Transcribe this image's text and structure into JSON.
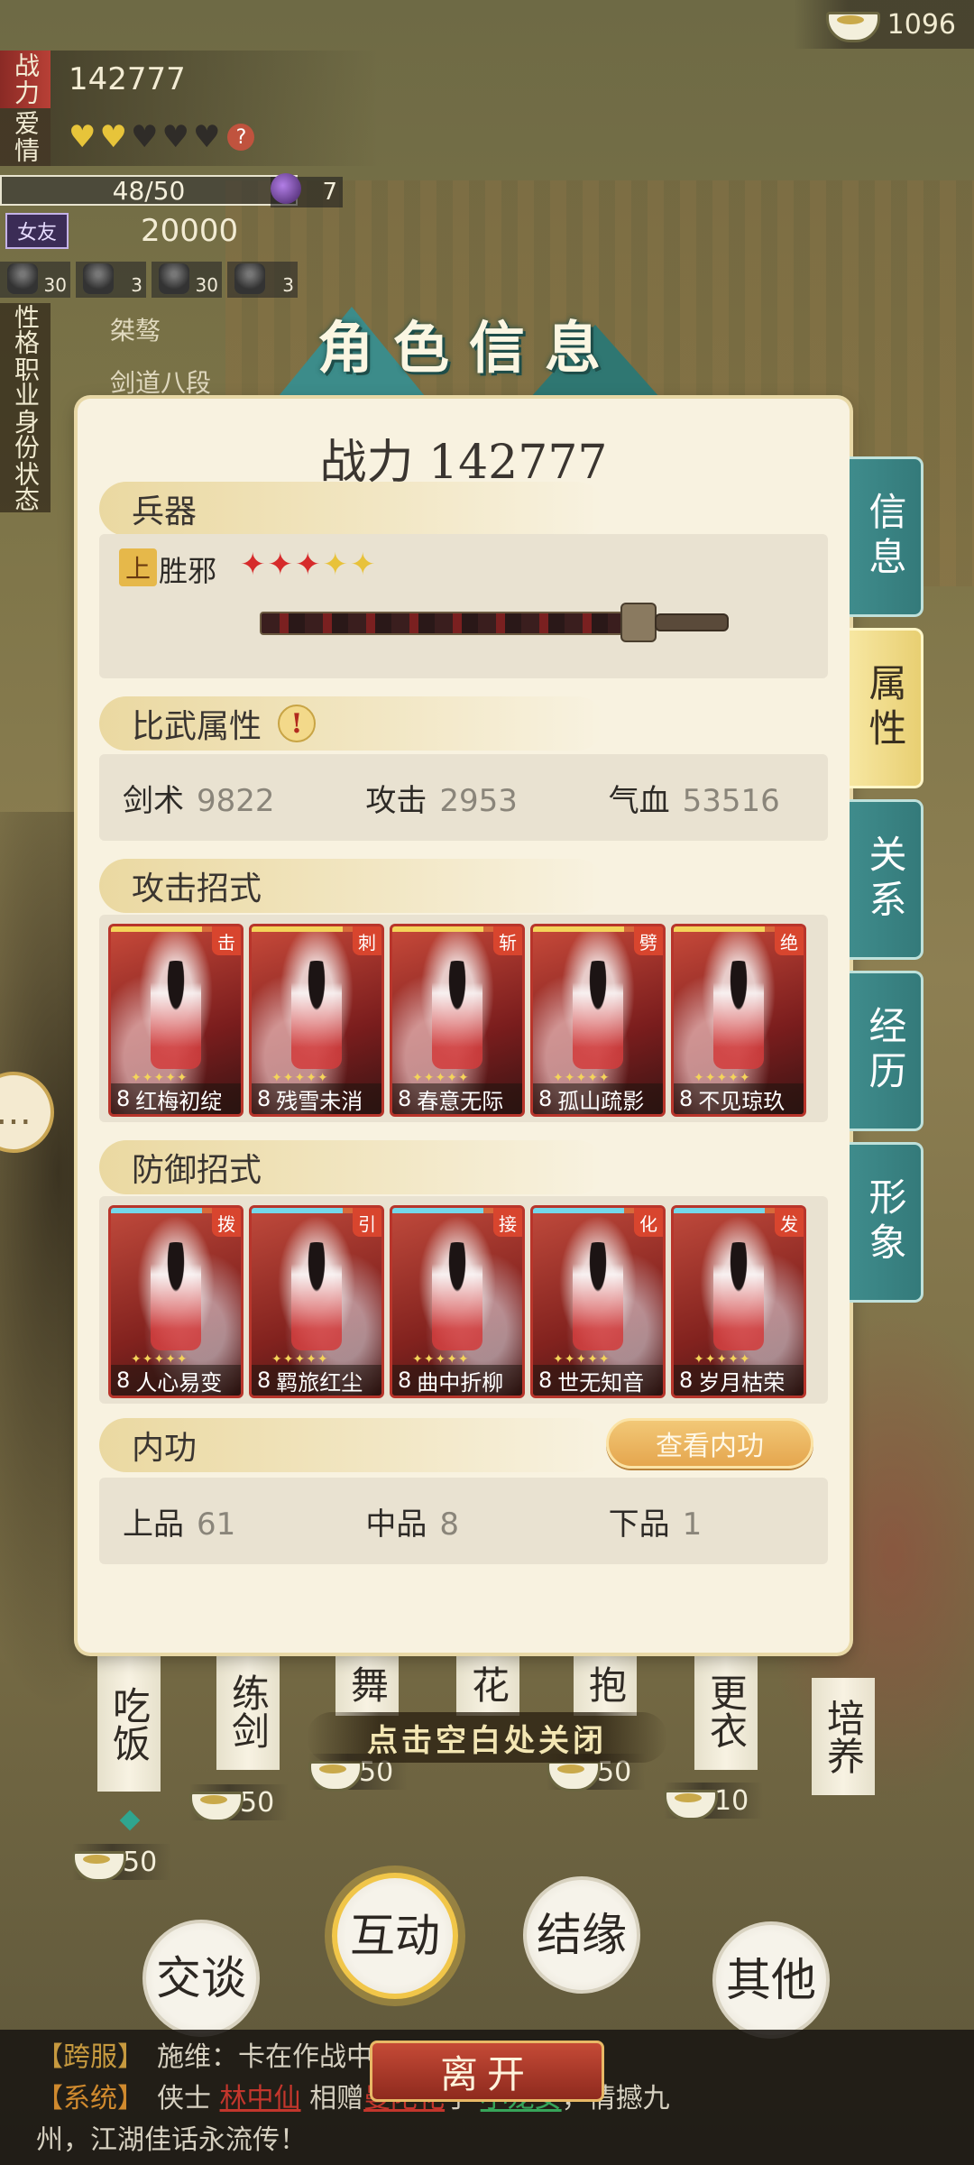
{
  "currency": {
    "icon": "rice-bowl-icon",
    "value": "1096"
  },
  "stats": {
    "power_label": "战力",
    "power_value": "142777",
    "love_label": "爱情",
    "hearts": {
      "filled": 2,
      "total": 5
    },
    "affection": "48/50",
    "gem_count": "7",
    "friend_badge": "女友",
    "friend_value": "20000",
    "gear": [
      "30",
      "3",
      "30",
      "3"
    ],
    "attributes": [
      {
        "label": "性格",
        "value": "桀骜"
      },
      {
        "label": "职业",
        "value": "剑道八段"
      },
      {
        "label": "身份",
        "value": ""
      },
      {
        "label": "状态",
        "value": ""
      }
    ]
  },
  "modal": {
    "title": "角色信息",
    "power": "战力 142777",
    "weapon": {
      "section": "兵器",
      "grade": "上",
      "name": "胜邪",
      "stars_red": 3,
      "stars_gold": 2
    },
    "combat": {
      "section": "比武属性",
      "items": [
        {
          "label": "剑术",
          "value": "9822"
        },
        {
          "label": "攻击",
          "value": "2953"
        },
        {
          "label": "气血",
          "value": "53516"
        }
      ]
    },
    "attack_moves": {
      "section": "攻击招式",
      "cards": [
        {
          "tag": "击",
          "level": "8",
          "name": "红梅初绽"
        },
        {
          "tag": "刺",
          "level": "8",
          "name": "残雪未消"
        },
        {
          "tag": "斩",
          "level": "8",
          "name": "春意无际"
        },
        {
          "tag": "劈",
          "level": "8",
          "name": "孤山疏影"
        },
        {
          "tag": "绝",
          "level": "8",
          "name": "不见琼玖"
        }
      ]
    },
    "defense_moves": {
      "section": "防御招式",
      "cards": [
        {
          "tag": "拨",
          "level": "8",
          "name": "人心易变"
        },
        {
          "tag": "引",
          "level": "8",
          "name": "羁旅红尘"
        },
        {
          "tag": "接",
          "level": "8",
          "name": "曲中折柳"
        },
        {
          "tag": "化",
          "level": "8",
          "name": "世无知音"
        },
        {
          "tag": "发",
          "level": "8",
          "name": "岁月枯荣"
        }
      ]
    },
    "neigong": {
      "section": "内功",
      "button": "查看内功",
      "items": [
        {
          "label": "上品",
          "value": "61"
        },
        {
          "label": "中品",
          "value": "8"
        },
        {
          "label": "下品",
          "value": "1"
        }
      ]
    }
  },
  "side_tabs": [
    {
      "label": "信息",
      "active": false
    },
    {
      "label": "属性",
      "active": true
    },
    {
      "label": "关系",
      "active": false
    },
    {
      "label": "经历",
      "active": false
    },
    {
      "label": "形象",
      "active": false
    }
  ],
  "scene": {
    "close_hint": "点击空白处关闭",
    "actions": [
      {
        "label": "吃饭",
        "cost": "50"
      },
      {
        "label": "练剑",
        "cost": "50"
      },
      {
        "label": "舞",
        "cost": "50"
      },
      {
        "label": "花",
        "cost": "50"
      },
      {
        "label": "抱",
        "cost": "50"
      },
      {
        "label": "更衣",
        "cost": "10"
      },
      {
        "label": "培养",
        "cost": ""
      }
    ],
    "circle_buttons": [
      {
        "label": "交谈",
        "active": false
      },
      {
        "label": "互动",
        "active": true
      },
      {
        "label": "结缘",
        "active": false
      },
      {
        "label": "其他",
        "active": false
      }
    ]
  },
  "log": {
    "line1_tag": "【跨服】",
    "line1_text": "施维：卡在作战中……也没用",
    "line2_tag": "【系统】",
    "line2_pre": "侠士",
    "line2_name1": "林中仙",
    "line2_mid": "相赠",
    "line2_name2": "曼陀花",
    "line2_yu": "于",
    "line2_name3": "小龙女",
    "line2_post": "，情撼九",
    "line3": "州，江湖佳话永流传！",
    "leave": "离开"
  }
}
